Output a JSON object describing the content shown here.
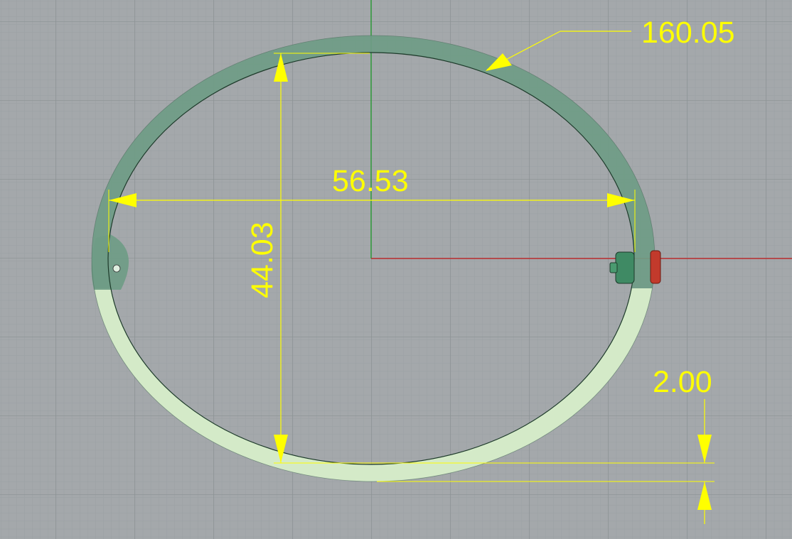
{
  "viewport": {
    "background": "#a4a8ab",
    "grid_minor_color": "#98a0a4",
    "grid_major_color": "#8c9296",
    "axis_x_color": "#c01818",
    "axis_y_color": "#18a018"
  },
  "dimensions": {
    "color": "#ffff00",
    "circumference": "160.05",
    "width": "56.53",
    "height": "44.03",
    "thickness": "2.00"
  },
  "model": {
    "ring_upper_color": "#6f9c86",
    "ring_lower_color": "#d4eac8",
    "hinge_color": "#3f8a64",
    "clasp_color": "#c23a2c"
  }
}
